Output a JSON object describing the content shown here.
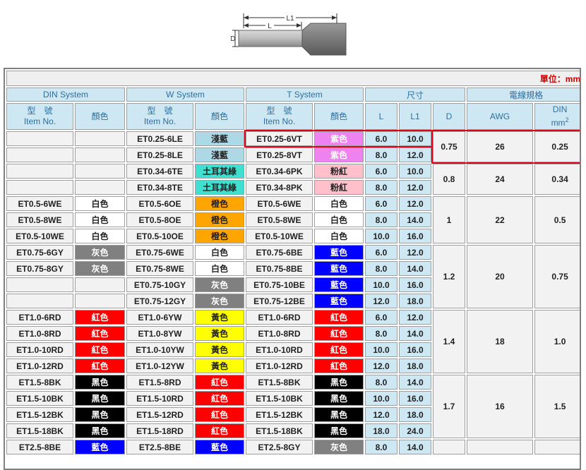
{
  "diagram": {
    "labels": {
      "l1": "L1",
      "l": "L",
      "d": "D"
    }
  },
  "unit_label": "單位：mm",
  "group_headers": {
    "din": "DIN System",
    "w": "W System",
    "t": "T System",
    "size": "尺寸",
    "wire": "電線規格"
  },
  "sub_headers": {
    "model_line1": "型　號",
    "model_line2": "Item No.",
    "color": "顏色",
    "l": "L",
    "l1": "L1",
    "d": "D",
    "awg": "AWG",
    "din_line1": "DIN",
    "din_line2": "mm²"
  },
  "colors": {
    "light_blue": "#add8e6",
    "violet": "#ee82ee",
    "turquoise": "#40e0d0",
    "pink": "#ffc0cb",
    "white": "#ffffff",
    "orange": "#ffa500",
    "gray": "#808080",
    "blue": "#0000ff",
    "red": "#ff0000",
    "yellow": "#ffff00",
    "black": "#000000",
    "header_blue": "#cde7f3",
    "highlight_red": "#e3001b"
  },
  "rows": [
    {
      "din": "",
      "din_c": "",
      "din_cn": "",
      "w": "ET0.25-6LE",
      "w_c": "淺藍",
      "w_cn": "light_blue",
      "t": "ET0.25-6VT",
      "t_c": "紫色",
      "t_cn": "violet",
      "l": "6.0",
      "l1": "10.0"
    },
    {
      "din": "",
      "din_c": "",
      "din_cn": "",
      "w": "ET0.25-8LE",
      "w_c": "淺藍",
      "w_cn": "light_blue",
      "t": "ET0.25-8VT",
      "t_c": "紫色",
      "t_cn": "violet",
      "l": "8.0",
      "l1": "12.0"
    },
    {
      "din": "",
      "din_c": "",
      "din_cn": "",
      "w": "ET0.34-6TE",
      "w_c": "土耳其綠",
      "w_cn": "turquoise",
      "t": "ET0.34-6PK",
      "t_c": "粉紅",
      "t_cn": "pink",
      "l": "6.0",
      "l1": "10.0"
    },
    {
      "din": "",
      "din_c": "",
      "din_cn": "",
      "w": "ET0.34-8TE",
      "w_c": "土耳其綠",
      "w_cn": "turquoise",
      "t": "ET0.34-8PK",
      "t_c": "粉紅",
      "t_cn": "pink",
      "l": "8.0",
      "l1": "12.0"
    },
    {
      "din": "ET0.5-6WE",
      "din_c": "白色",
      "din_cn": "white",
      "w": "ET0.5-6OE",
      "w_c": "橙色",
      "w_cn": "orange",
      "t": "ET0.5-6WE",
      "t_c": "白色",
      "t_cn": "white",
      "l": "6.0",
      "l1": "12.0"
    },
    {
      "din": "ET0.5-8WE",
      "din_c": "白色",
      "din_cn": "white",
      "w": "ET0.5-8OE",
      "w_c": "橙色",
      "w_cn": "orange",
      "t": "ET0.5-8WE",
      "t_c": "白色",
      "t_cn": "white",
      "l": "8.0",
      "l1": "14.0"
    },
    {
      "din": "ET0.5-10WE",
      "din_c": "白色",
      "din_cn": "white",
      "w": "ET0.5-10OE",
      "w_c": "橙色",
      "w_cn": "orange",
      "t": "ET0.5-10WE",
      "t_c": "白色",
      "t_cn": "white",
      "l": "10.0",
      "l1": "16.0"
    },
    {
      "din": "ET0.75-6GY",
      "din_c": "灰色",
      "din_cn": "gray",
      "w": "ET0.75-6WE",
      "w_c": "白色",
      "w_cn": "white",
      "t": "ET0.75-6BE",
      "t_c": "藍色",
      "t_cn": "blue",
      "l": "6.0",
      "l1": "12.0"
    },
    {
      "din": "ET0.75-8GY",
      "din_c": "灰色",
      "din_cn": "gray",
      "w": "ET0.75-8WE",
      "w_c": "白色",
      "w_cn": "white",
      "t": "ET0.75-8BE",
      "t_c": "藍色",
      "t_cn": "blue",
      "l": "8.0",
      "l1": "14.0"
    },
    {
      "din": "",
      "din_c": "",
      "din_cn": "",
      "w": "ET0.75-10GY",
      "w_c": "灰色",
      "w_cn": "gray",
      "t": "ET0.75-10BE",
      "t_c": "藍色",
      "t_cn": "blue",
      "l": "10.0",
      "l1": "16.0"
    },
    {
      "din": "",
      "din_c": "",
      "din_cn": "",
      "w": "ET0.75-12GY",
      "w_c": "灰色",
      "w_cn": "gray",
      "t": "ET0.75-12BE",
      "t_c": "藍色",
      "t_cn": "blue",
      "l": "12.0",
      "l1": "18.0"
    },
    {
      "din": "ET1.0-6RD",
      "din_c": "紅色",
      "din_cn": "red",
      "w": "ET1.0-6YW",
      "w_c": "黃色",
      "w_cn": "yellow",
      "t": "ET1.0-6RD",
      "t_c": "紅色",
      "t_cn": "red",
      "l": "6.0",
      "l1": "12.0"
    },
    {
      "din": "ET1.0-8RD",
      "din_c": "紅色",
      "din_cn": "red",
      "w": "ET1.0-8YW",
      "w_c": "黃色",
      "w_cn": "yellow",
      "t": "ET1.0-8RD",
      "t_c": "紅色",
      "t_cn": "red",
      "l": "8.0",
      "l1": "14.0"
    },
    {
      "din": "ET1.0-10RD",
      "din_c": "紅色",
      "din_cn": "red",
      "w": "ET1.0-10YW",
      "w_c": "黃色",
      "w_cn": "yellow",
      "t": "ET1.0-10RD",
      "t_c": "紅色",
      "t_cn": "red",
      "l": "10.0",
      "l1": "16.0"
    },
    {
      "din": "ET1.0-12RD",
      "din_c": "紅色",
      "din_cn": "red",
      "w": "ET1.0-12YW",
      "w_c": "黃色",
      "w_cn": "yellow",
      "t": "ET1.0-12RD",
      "t_c": "紅色",
      "t_cn": "red",
      "l": "12.0",
      "l1": "18.0"
    },
    {
      "din": "ET1.5-8BK",
      "din_c": "黑色",
      "din_cn": "black",
      "w": "ET1.5-8RD",
      "w_c": "紅色",
      "w_cn": "red",
      "t": "ET1.5-8BK",
      "t_c": "黑色",
      "t_cn": "black",
      "l": "8.0",
      "l1": "14.0"
    },
    {
      "din": "ET1.5-10BK",
      "din_c": "黑色",
      "din_cn": "black",
      "w": "ET1.5-10RD",
      "w_c": "紅色",
      "w_cn": "red",
      "t": "ET1.5-10BK",
      "t_c": "黑色",
      "t_cn": "black",
      "l": "10.0",
      "l1": "16.0"
    },
    {
      "din": "ET1.5-12BK",
      "din_c": "黑色",
      "din_cn": "black",
      "w": "ET1.5-12RD",
      "w_c": "紅色",
      "w_cn": "red",
      "t": "ET1.5-12BK",
      "t_c": "黑色",
      "t_cn": "black",
      "l": "12.0",
      "l1": "18.0"
    },
    {
      "din": "ET1.5-18BK",
      "din_c": "黑色",
      "din_cn": "black",
      "w": "ET1.5-18RD",
      "w_c": "紅色",
      "w_cn": "red",
      "t": "ET1.5-18BK",
      "t_c": "黑色",
      "t_cn": "black",
      "l": "18.0",
      "l1": "24.0"
    },
    {
      "din": "ET2.5-8BE",
      "din_c": "藍色",
      "din_cn": "blue",
      "w": "ET2.5-8BE",
      "w_c": "藍色",
      "w_cn": "blue",
      "t": "ET2.5-8GY",
      "t_c": "灰色",
      "t_cn": "gray",
      "l": "8.0",
      "l1": "14.0"
    }
  ],
  "groups": [
    {
      "rows": 2,
      "d": "0.75",
      "awg": "26",
      "din": "0.25"
    },
    {
      "rows": 2,
      "d": "0.8",
      "awg": "24",
      "din": "0.34"
    },
    {
      "rows": 3,
      "d": "1",
      "awg": "22",
      "din": "0.5"
    },
    {
      "rows": 4,
      "d": "1.2",
      "awg": "20",
      "din": "0.75"
    },
    {
      "rows": 4,
      "d": "1.4",
      "awg": "18",
      "din": "1.0"
    },
    {
      "rows": 4,
      "d": "1.7",
      "awg": "16",
      "din": "1.5"
    },
    {
      "rows": 1,
      "d": "",
      "awg": "",
      "din": ""
    }
  ]
}
